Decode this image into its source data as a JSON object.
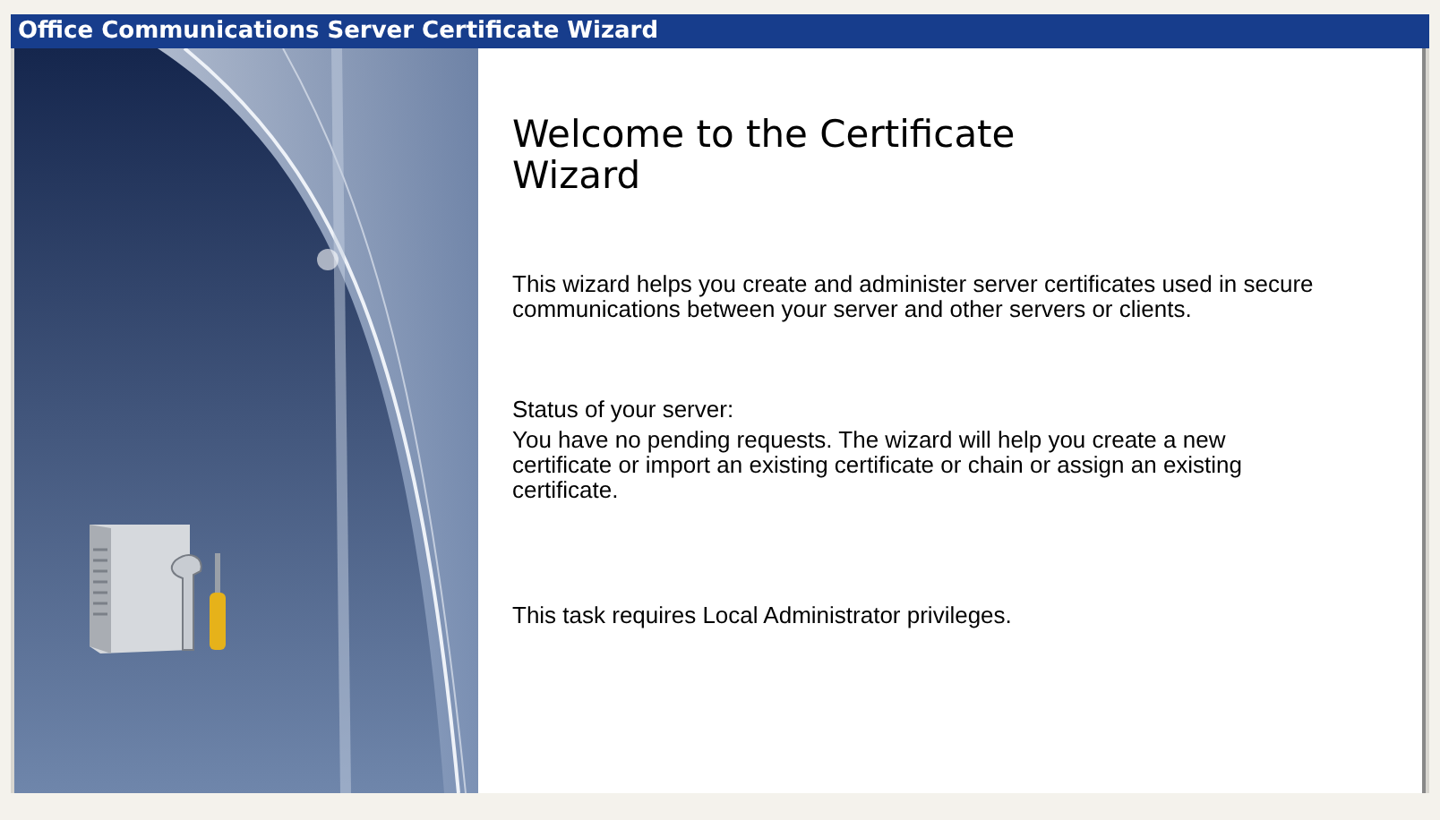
{
  "window": {
    "title": "Office Communications Server Certificate Wizard"
  },
  "heading": "Welcome to the Certificate Wizard",
  "intro": "This wizard helps you create and administer server certificates used in secure communications between your server and other servers or clients.",
  "status": {
    "label": "Status of your server:",
    "text": "You have no pending requests. The wizard will help you create a new certificate or import an existing certificate or chain or assign an existing certificate."
  },
  "note": "This task requires Local Administrator privileges."
}
